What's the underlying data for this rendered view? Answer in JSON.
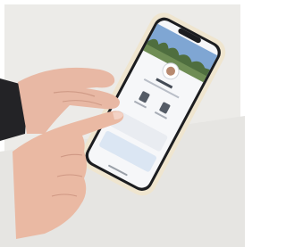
{
  "scene": {
    "phone_screen": {
      "app_title": "",
      "subtitle": ""
    }
  },
  "colors": {
    "background": "#ecebe8",
    "phone_case": "#efe5cf",
    "screen_bg": "#f6f7f9",
    "sky": "#7fa6d3",
    "grass": "#6f8d55",
    "skin": "#e8b8a4",
    "sleeve": "#232326"
  }
}
